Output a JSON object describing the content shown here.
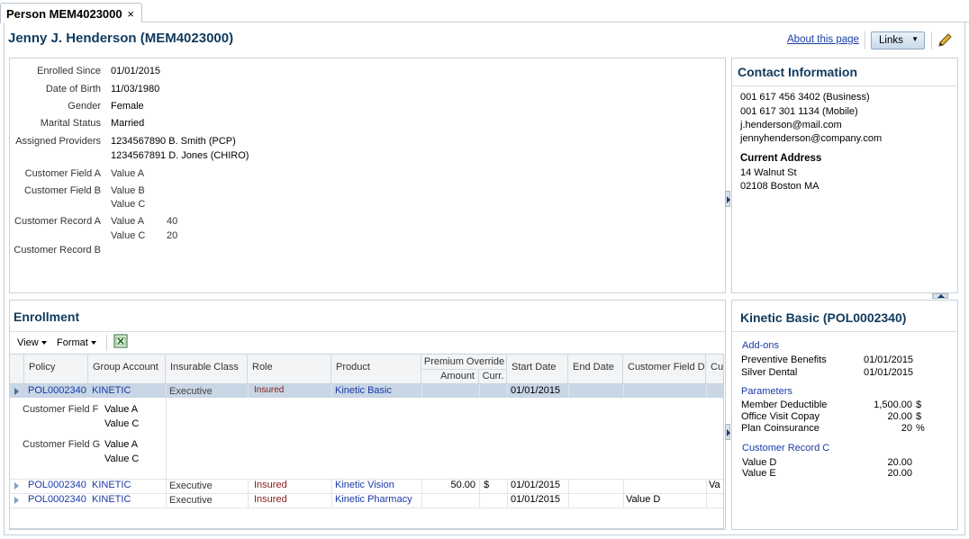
{
  "tab": {
    "label": "Person MEM4023000",
    "close": "×"
  },
  "header": {
    "title": "Jenny J. Henderson (MEM4023000)",
    "about": "About this page",
    "links": "Links"
  },
  "person": {
    "fields": [
      {
        "label": "Enrolled Since",
        "values": [
          "01/01/2015"
        ],
        "link": false
      },
      {
        "label": "Date of Birth",
        "values": [
          "11/03/1980"
        ],
        "link": false
      },
      {
        "label": "Gender",
        "values": [
          "Female"
        ],
        "link": false
      },
      {
        "label": "Marital Status",
        "values": [
          "Married"
        ],
        "link": false
      }
    ],
    "assigned_providers": {
      "label": "Assigned Providers",
      "values": [
        "1234567890 B. Smith (PCP)",
        "1234567891 D. Jones (CHIRO)"
      ]
    },
    "customer_field_a": {
      "label": "Customer Field A",
      "values": [
        "Value A"
      ]
    },
    "customer_field_b": {
      "label": "Customer Field B",
      "values": [
        "Value B",
        "Value C"
      ]
    },
    "customer_record_a": {
      "label": "Customer Record A",
      "rows": [
        [
          "Value A",
          "40"
        ],
        [
          "Value C",
          "20"
        ]
      ]
    },
    "customer_record_b": {
      "label": "Customer Record B"
    }
  },
  "contact": {
    "title": "Contact Information",
    "lines": [
      "001 617 456 3402 (Business)",
      "001 617 301 1134 (Mobile)",
      "j.henderson@mail.com",
      "jennyhenderson@company.com"
    ],
    "address_title": "Current Address",
    "address": [
      "14 Walnut St",
      "02108 Boston MA"
    ]
  },
  "enrollment": {
    "title": "Enrollment",
    "toolbar": {
      "view": "View",
      "format": "Format"
    },
    "columns": {
      "policy": "Policy",
      "group": "Group Account",
      "insurable": "Insurable Class",
      "role": "Role",
      "product": "Product",
      "premium": "Premium Override",
      "amount": "Amount",
      "curr": "Curr.",
      "start": "Start Date",
      "end": "End Date",
      "cfd": "Customer Field D",
      "cu": "Cu"
    },
    "rows": [
      {
        "policy": "POL0002340",
        "group": "KINETIC",
        "insurable": "Executive",
        "role": "Insured",
        "product": "Kinetic Basic",
        "amount": "",
        "curr": "",
        "start": "01/01/2015",
        "end": "",
        "cfd": "",
        "cu": ""
      },
      {
        "policy": "POL0002340",
        "group": "KINETIC",
        "insurable": "Executive",
        "role": "Insured",
        "product": "Kinetic Vision",
        "amount": "50.00",
        "curr": "$",
        "start": "01/01/2015",
        "end": "",
        "cfd": "",
        "cu": "Va"
      },
      {
        "policy": "POL0002340",
        "group": "KINETIC",
        "insurable": "Executive",
        "role": "Insured",
        "product": "Kinetic Pharmacy",
        "amount": "",
        "curr": "",
        "start": "01/01/2015",
        "end": "",
        "cfd": "Value D",
        "cu": ""
      }
    ],
    "detail": {
      "field_f": {
        "label": "Customer Field F",
        "values": [
          "Value A",
          "Value C"
        ]
      },
      "field_g": {
        "label": "Customer Field G",
        "values": [
          "Value A",
          "Value C"
        ]
      }
    }
  },
  "policy_panel": {
    "title": "Kinetic Basic (POL0002340)",
    "addons_title": "Add-ons",
    "addons": [
      [
        "Preventive Benefits",
        "01/01/2015"
      ],
      [
        "Silver Dental",
        "01/01/2015"
      ]
    ],
    "params_title": "Parameters",
    "params": [
      [
        "Member Deductible",
        "1,500.00",
        "$"
      ],
      [
        "Office Visit Copay",
        "20.00",
        "$"
      ],
      [
        "Plan Coinsurance",
        "20",
        "%"
      ]
    ],
    "record_title": "Customer Record C",
    "record": [
      [
        "Value D",
        "20.00"
      ],
      [
        "Value E",
        "20.00"
      ]
    ]
  }
}
